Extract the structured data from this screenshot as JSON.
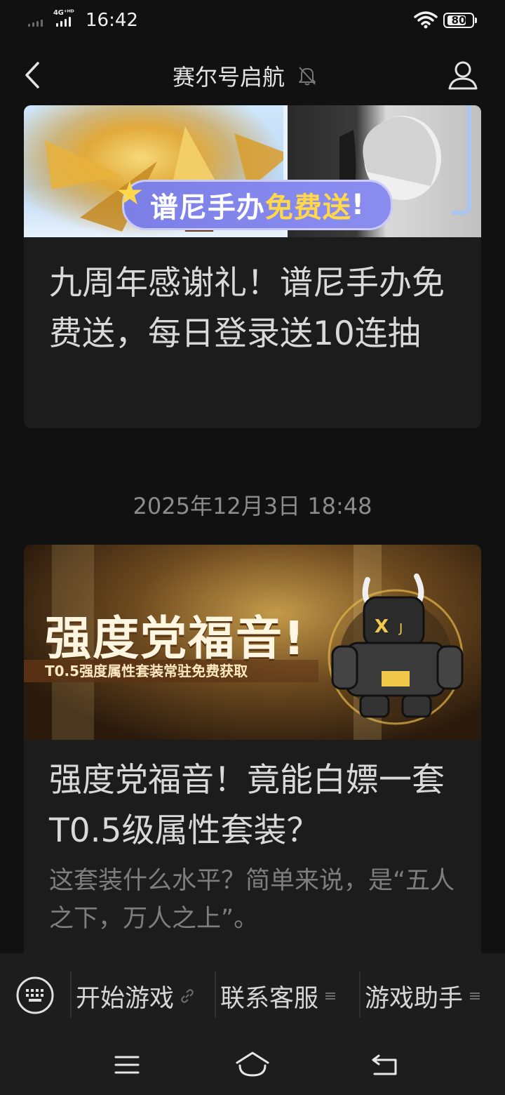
{
  "status_bar": {
    "network": "4G⁺ᴴᴰ",
    "time": "16:42",
    "battery": "80"
  },
  "header": {
    "title": "赛尔号启航",
    "back_icon": "chevron-left-icon",
    "mute_icon": "bell-off-icon",
    "profile_icon": "person-icon"
  },
  "articles": [
    {
      "banner_text_a": "谱尼手办",
      "banner_text_b": "免费送",
      "banner_text_c": "!",
      "title": "九周年感谢礼！谱尼手办免费送，每日登录送10连抽"
    },
    {
      "date": "2025年12月3日 18:48",
      "banner_big": "强度党福音!",
      "banner_sub": "T0.5强度属性套装常驻免费获取",
      "title": "强度党福音！竟能白嫖一套T0.5级属性套装？",
      "desc": "这套装什么水平？简单来说，是“五人之下，万人之上”。"
    }
  ],
  "menu": {
    "keyboard_icon": "keyboard-icon",
    "items": [
      {
        "label": "开始游戏",
        "icon": "link-icon"
      },
      {
        "label": "联系客服",
        "icon": "menu-lines-icon"
      },
      {
        "label": "游戏助手",
        "icon": "menu-lines-icon"
      }
    ]
  },
  "system_nav": {
    "icons": [
      "menu-icon",
      "home-icon",
      "back-icon"
    ]
  }
}
